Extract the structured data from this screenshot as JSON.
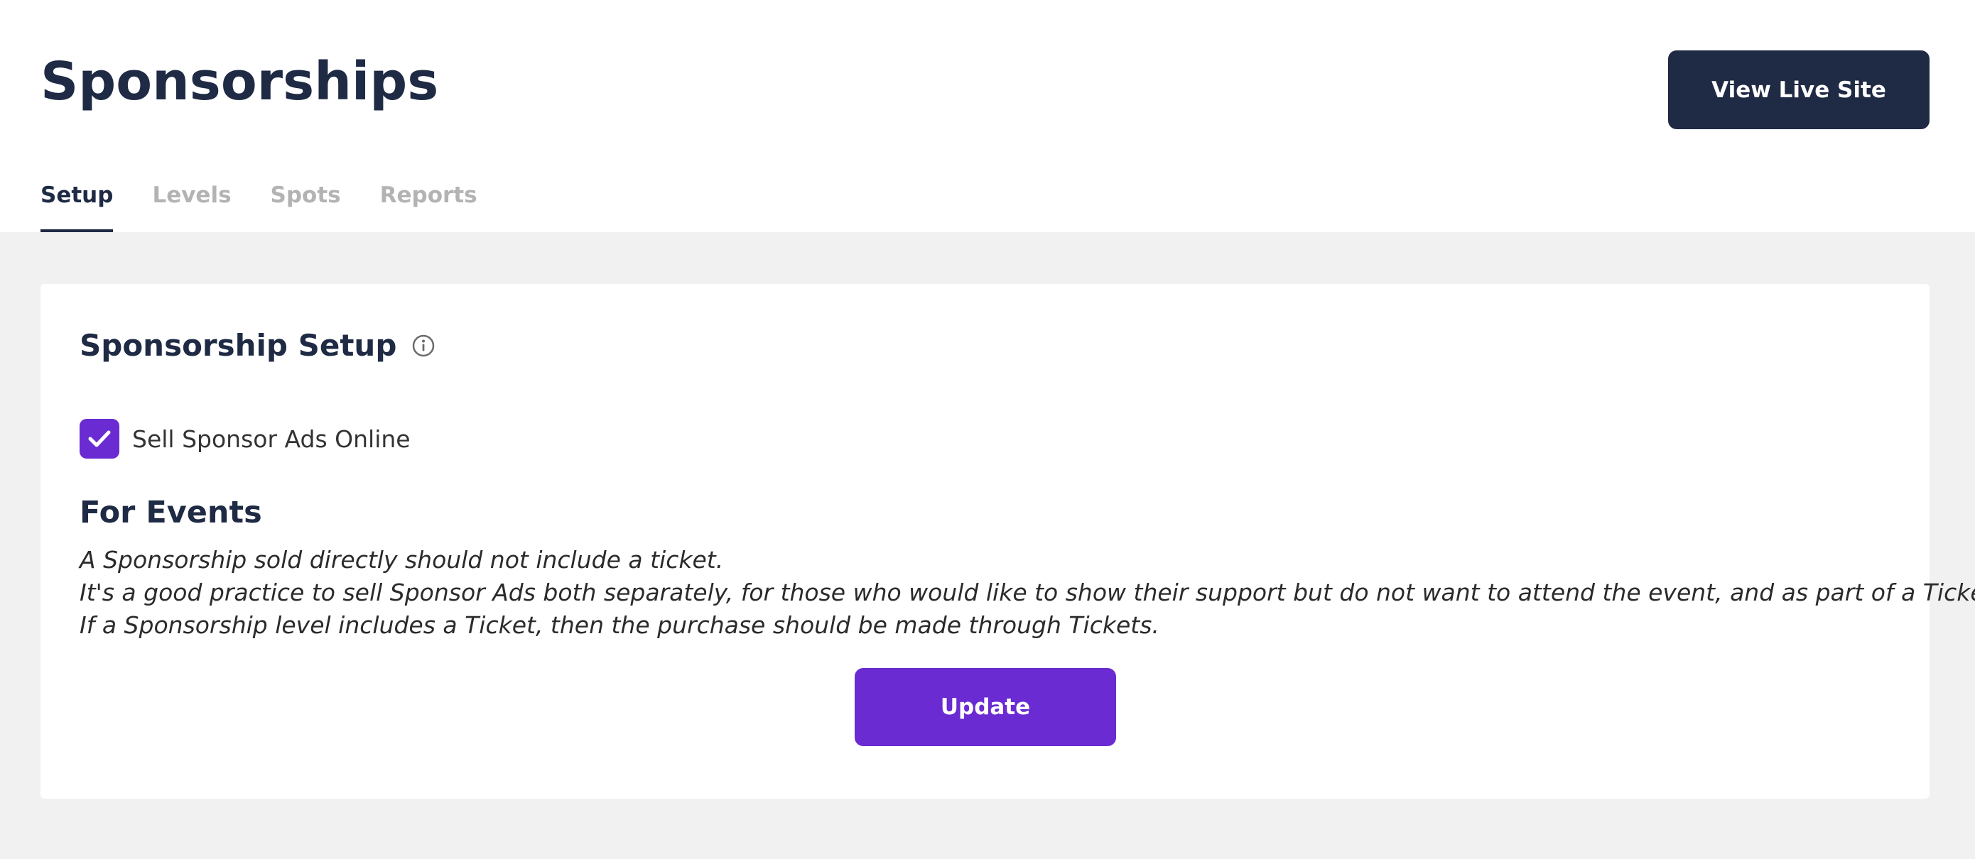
{
  "header": {
    "title": "Sponsorships",
    "view_live_site_label": "View Live Site"
  },
  "tabs": [
    {
      "label": "Setup",
      "active": true
    },
    {
      "label": "Levels",
      "active": false
    },
    {
      "label": "Spots",
      "active": false
    },
    {
      "label": "Reports",
      "active": false
    }
  ],
  "card": {
    "title": "Sponsorship Setup",
    "info_icon": "info-circle-icon",
    "checkbox": {
      "label": "Sell Sponsor Ads Online",
      "checked": true
    },
    "section_title": "For Events",
    "notes": [
      "A Sponsorship sold directly should not include a ticket.",
      "It's a good practice to sell Sponsor Ads both separately, for those who would like to show their support but do not want to attend the event, and as part of a Ticket.",
      "If a Sponsorship level includes a Ticket, then the purchase should be made through Tickets."
    ],
    "update_label": "Update"
  },
  "colors": {
    "primary_dark": "#1f2a44",
    "accent_purple": "#6a2bd2",
    "page_background": "#f1f1f1",
    "inactive_tab": "#b3b3b3"
  }
}
